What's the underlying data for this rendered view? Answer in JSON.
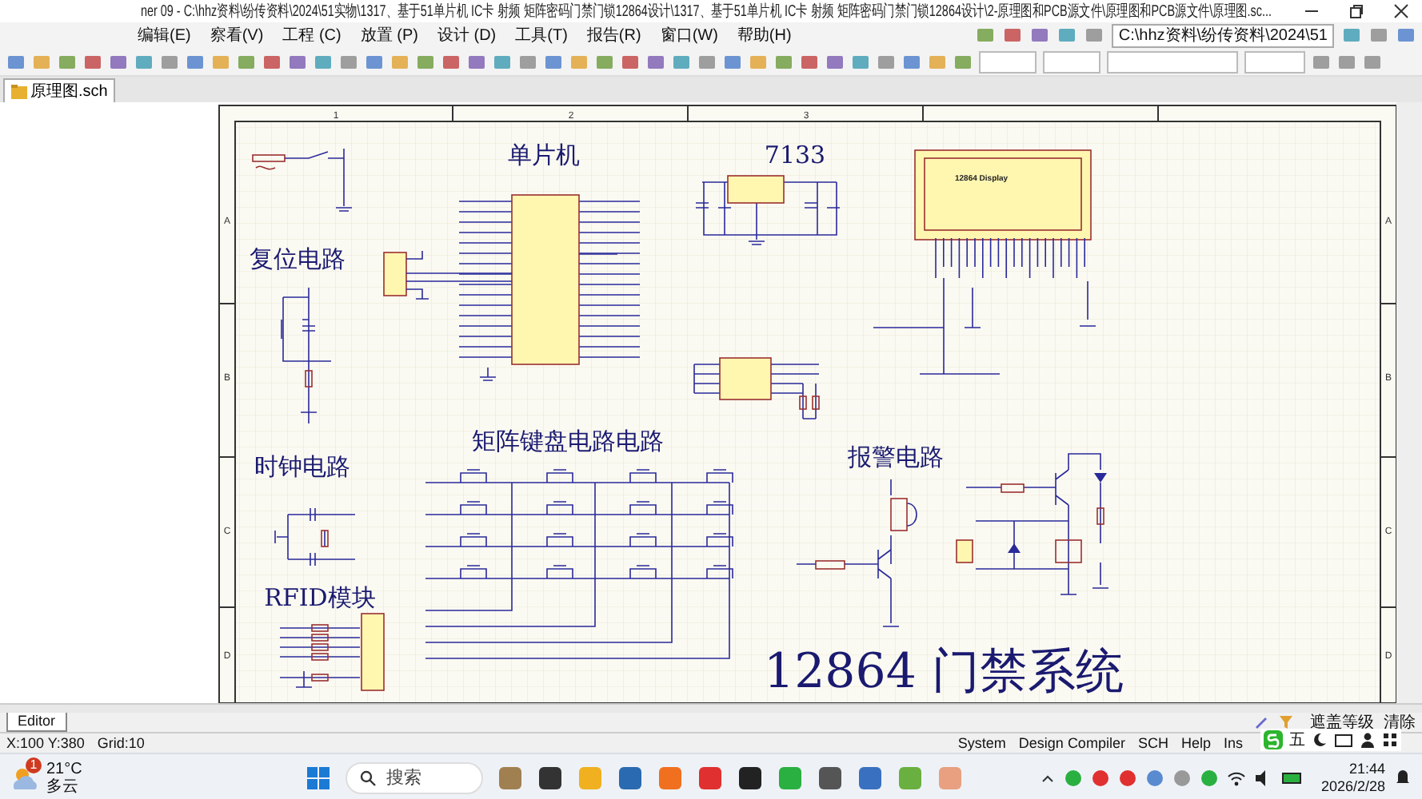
{
  "title_bar": {
    "title": "ner 09 - C:\\hhz资料\\纷传资料\\2024\\51实物\\1317、基于51单片机 IC卡 射频 矩阵密码门禁门锁12864设计\\1317、基于51单片机 IC卡 射频 矩阵密码门禁门锁12864设计\\2-原理图和PCB源文件\\原理图和PCB源文件\\原理图.sc..."
  },
  "menu": [
    {
      "label": "编辑(E)"
    },
    {
      "label": "察看(V)"
    },
    {
      "label": "工程 (C)"
    },
    {
      "label": "放置 (P)"
    },
    {
      "label": "设计 (D)"
    },
    {
      "label": "工具(T)"
    },
    {
      "label": "报告(R)"
    },
    {
      "label": "窗口(W)"
    },
    {
      "label": "帮助(H)"
    }
  ],
  "path_box": {
    "value": "C:\\hhz资料\\纷传资料\\2024\\51"
  },
  "document_tabs": [
    {
      "label": "原理图.sch",
      "selected": true
    }
  ],
  "schematic": {
    "zone_columns": [
      "1",
      "2",
      "3"
    ],
    "zone_rows_left": [
      "A",
      "B",
      "C",
      "D"
    ],
    "zone_rows_right": [
      "A",
      "B",
      "C",
      "D"
    ],
    "section_titles": [
      {
        "text": "单片机"
      },
      {
        "text": "7133"
      },
      {
        "text": "复位电路"
      },
      {
        "text": "时钟电路"
      },
      {
        "text": "矩阵键盘电路电路"
      },
      {
        "text": "报警电路"
      },
      {
        "text": "RFID模块"
      }
    ],
    "lcd_label": "12864 Display",
    "sheet_title": "12864 门禁系统"
  },
  "editor_tabs": [
    {
      "label": "Editor",
      "selected": true
    }
  ],
  "mask_controls": [
    "遮盖等级",
    "清除"
  ],
  "status_bar": {
    "coordinates": "X:100 Y:380",
    "grid": "Grid:10",
    "panels": [
      "System",
      "Design Compiler",
      "SCH",
      "Help",
      "Ins"
    ]
  },
  "ime_bar": {
    "mode": "五"
  },
  "taskbar": {
    "weather": {
      "badge": "1",
      "temperature": "21°C",
      "condition": "多云"
    },
    "search": {
      "placeholder": "搜索"
    },
    "time": "21:44",
    "date": "2026/2/28"
  }
}
